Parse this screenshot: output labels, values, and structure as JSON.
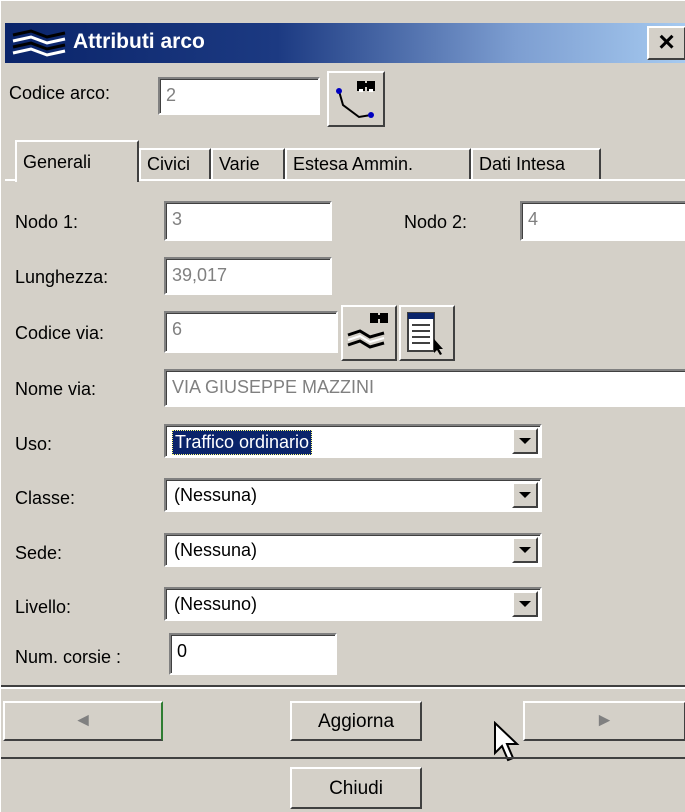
{
  "window": {
    "title": "Attributi arco",
    "close_glyph": "×",
    "icon": "road-map-icon"
  },
  "header": {
    "codice_arco_label": "Codice arco:",
    "codice_arco_value": "2",
    "find_arc_icon": "binoculars-path-icon"
  },
  "tabs": [
    {
      "label": "Generali",
      "selected": true
    },
    {
      "label": "Civici",
      "selected": false
    },
    {
      "label": "Varie",
      "selected": false
    },
    {
      "label": "Estesa Ammin.",
      "selected": false
    },
    {
      "label": "Dati Intesa",
      "selected": false
    }
  ],
  "form": {
    "nodo1_label": "Nodo 1:",
    "nodo1_value": "3",
    "nodo2_label": "Nodo 2:",
    "nodo2_value": "4",
    "lunghezza_label": "Lunghezza:",
    "lunghezza_value": "39,017",
    "codice_via_label": "Codice via:",
    "codice_via_value": "6",
    "nome_via_label": "Nome via:",
    "nome_via_value": "VIA GIUSEPPE MAZZINI",
    "uso_label": "Uso:",
    "uso_value": "Traffico ordinario",
    "classe_label": "Classe:",
    "classe_value": "(Nessuna)",
    "sede_label": "Sede:",
    "sede_value": "(Nessuna)",
    "livello_label": "Livello:",
    "livello_value": "(Nessuno)",
    "num_corsie_label": "Num. corsie :",
    "num_corsie_value": "0"
  },
  "footer": {
    "prev_glyph": "◄",
    "next_glyph": "►",
    "aggiorna_label": "Aggiorna",
    "chiudi_label": "Chiudi"
  },
  "colors": {
    "titlebar": "#0a246a",
    "face": "#d4d0c8",
    "selection": "#0a246a"
  }
}
